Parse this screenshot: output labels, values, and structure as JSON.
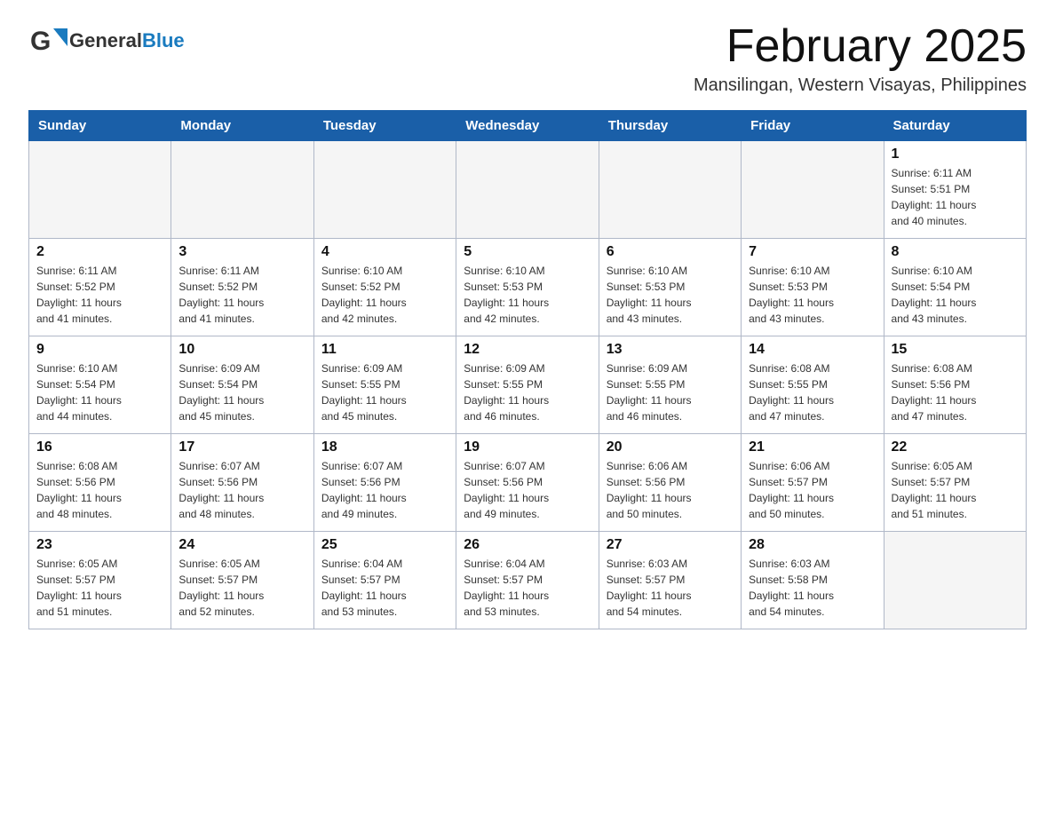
{
  "header": {
    "logo_general": "General",
    "logo_blue": "Blue",
    "month_title": "February 2025",
    "subtitle": "Mansilingan, Western Visayas, Philippines"
  },
  "weekdays": [
    "Sunday",
    "Monday",
    "Tuesday",
    "Wednesday",
    "Thursday",
    "Friday",
    "Saturday"
  ],
  "weeks": [
    [
      {
        "day": "",
        "info": ""
      },
      {
        "day": "",
        "info": ""
      },
      {
        "day": "",
        "info": ""
      },
      {
        "day": "",
        "info": ""
      },
      {
        "day": "",
        "info": ""
      },
      {
        "day": "",
        "info": ""
      },
      {
        "day": "1",
        "info": "Sunrise: 6:11 AM\nSunset: 5:51 PM\nDaylight: 11 hours\nand 40 minutes."
      }
    ],
    [
      {
        "day": "2",
        "info": "Sunrise: 6:11 AM\nSunset: 5:52 PM\nDaylight: 11 hours\nand 41 minutes."
      },
      {
        "day": "3",
        "info": "Sunrise: 6:11 AM\nSunset: 5:52 PM\nDaylight: 11 hours\nand 41 minutes."
      },
      {
        "day": "4",
        "info": "Sunrise: 6:10 AM\nSunset: 5:52 PM\nDaylight: 11 hours\nand 42 minutes."
      },
      {
        "day": "5",
        "info": "Sunrise: 6:10 AM\nSunset: 5:53 PM\nDaylight: 11 hours\nand 42 minutes."
      },
      {
        "day": "6",
        "info": "Sunrise: 6:10 AM\nSunset: 5:53 PM\nDaylight: 11 hours\nand 43 minutes."
      },
      {
        "day": "7",
        "info": "Sunrise: 6:10 AM\nSunset: 5:53 PM\nDaylight: 11 hours\nand 43 minutes."
      },
      {
        "day": "8",
        "info": "Sunrise: 6:10 AM\nSunset: 5:54 PM\nDaylight: 11 hours\nand 43 minutes."
      }
    ],
    [
      {
        "day": "9",
        "info": "Sunrise: 6:10 AM\nSunset: 5:54 PM\nDaylight: 11 hours\nand 44 minutes."
      },
      {
        "day": "10",
        "info": "Sunrise: 6:09 AM\nSunset: 5:54 PM\nDaylight: 11 hours\nand 45 minutes."
      },
      {
        "day": "11",
        "info": "Sunrise: 6:09 AM\nSunset: 5:55 PM\nDaylight: 11 hours\nand 45 minutes."
      },
      {
        "day": "12",
        "info": "Sunrise: 6:09 AM\nSunset: 5:55 PM\nDaylight: 11 hours\nand 46 minutes."
      },
      {
        "day": "13",
        "info": "Sunrise: 6:09 AM\nSunset: 5:55 PM\nDaylight: 11 hours\nand 46 minutes."
      },
      {
        "day": "14",
        "info": "Sunrise: 6:08 AM\nSunset: 5:55 PM\nDaylight: 11 hours\nand 47 minutes."
      },
      {
        "day": "15",
        "info": "Sunrise: 6:08 AM\nSunset: 5:56 PM\nDaylight: 11 hours\nand 47 minutes."
      }
    ],
    [
      {
        "day": "16",
        "info": "Sunrise: 6:08 AM\nSunset: 5:56 PM\nDaylight: 11 hours\nand 48 minutes."
      },
      {
        "day": "17",
        "info": "Sunrise: 6:07 AM\nSunset: 5:56 PM\nDaylight: 11 hours\nand 48 minutes."
      },
      {
        "day": "18",
        "info": "Sunrise: 6:07 AM\nSunset: 5:56 PM\nDaylight: 11 hours\nand 49 minutes."
      },
      {
        "day": "19",
        "info": "Sunrise: 6:07 AM\nSunset: 5:56 PM\nDaylight: 11 hours\nand 49 minutes."
      },
      {
        "day": "20",
        "info": "Sunrise: 6:06 AM\nSunset: 5:56 PM\nDaylight: 11 hours\nand 50 minutes."
      },
      {
        "day": "21",
        "info": "Sunrise: 6:06 AM\nSunset: 5:57 PM\nDaylight: 11 hours\nand 50 minutes."
      },
      {
        "day": "22",
        "info": "Sunrise: 6:05 AM\nSunset: 5:57 PM\nDaylight: 11 hours\nand 51 minutes."
      }
    ],
    [
      {
        "day": "23",
        "info": "Sunrise: 6:05 AM\nSunset: 5:57 PM\nDaylight: 11 hours\nand 51 minutes."
      },
      {
        "day": "24",
        "info": "Sunrise: 6:05 AM\nSunset: 5:57 PM\nDaylight: 11 hours\nand 52 minutes."
      },
      {
        "day": "25",
        "info": "Sunrise: 6:04 AM\nSunset: 5:57 PM\nDaylight: 11 hours\nand 53 minutes."
      },
      {
        "day": "26",
        "info": "Sunrise: 6:04 AM\nSunset: 5:57 PM\nDaylight: 11 hours\nand 53 minutes."
      },
      {
        "day": "27",
        "info": "Sunrise: 6:03 AM\nSunset: 5:57 PM\nDaylight: 11 hours\nand 54 minutes."
      },
      {
        "day": "28",
        "info": "Sunrise: 6:03 AM\nSunset: 5:58 PM\nDaylight: 11 hours\nand 54 minutes."
      },
      {
        "day": "",
        "info": ""
      }
    ]
  ]
}
